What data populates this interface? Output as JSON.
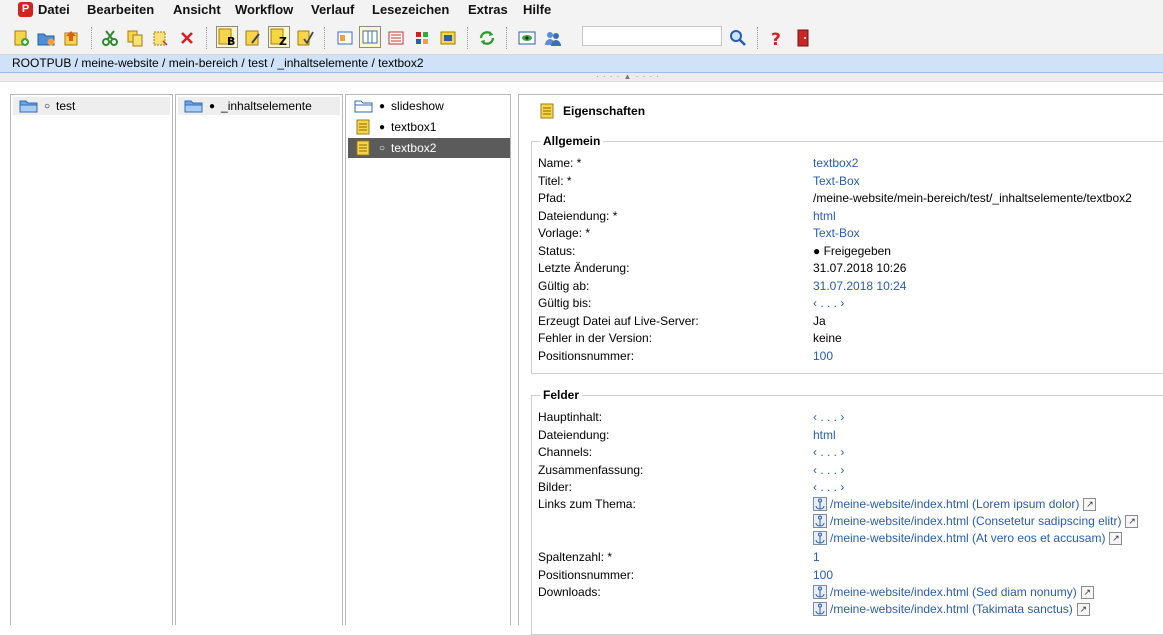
{
  "menu": [
    "Datei",
    "Bearbeiten",
    "Ansicht",
    "Workflow",
    "Verlauf",
    "Lesezeichen",
    "Extras",
    "Hilfe"
  ],
  "breadcrumb": "ROOTPUB / meine-website / mein-bereich / test / _inhaltselemente / textbox2",
  "search": {
    "value": ""
  },
  "columns": {
    "col1": [
      {
        "label": "test",
        "marker": "○"
      }
    ],
    "col2": [
      {
        "label": "_inhaltselemente",
        "marker": "●"
      }
    ],
    "col3": [
      {
        "label": "slideshow",
        "marker": "●"
      },
      {
        "label": "textbox1",
        "marker": "●"
      },
      {
        "label": "textbox2",
        "marker": "○"
      }
    ]
  },
  "properties": {
    "title": "Eigenschaften",
    "allgemein": {
      "legend": "Allgemein",
      "rows": [
        {
          "label": "Name: *",
          "value": "textbox2"
        },
        {
          "label": "Titel: *",
          "value": "Text-Box"
        },
        {
          "label": "Pfad:",
          "value": "/meine-website/mein-bereich/test/_inhaltselemente/textbox2"
        },
        {
          "label": "Dateiendung: *",
          "value": "html"
        },
        {
          "label": "Vorlage: *",
          "value": "Text-Box"
        },
        {
          "label": "Status:",
          "value": "● Freigegeben"
        },
        {
          "label": "Letzte Änderung:",
          "value": "31.07.2018 10:26"
        },
        {
          "label": "Gültig ab:",
          "value": "31.07.2018 10:24"
        },
        {
          "label": "Gültig bis:",
          "value": "‹ . . . ›"
        },
        {
          "label": "Erzeugt Datei auf Live-Server:",
          "value": "Ja"
        },
        {
          "label": "Fehler in der Version:",
          "value": "keine"
        },
        {
          "label": "Positionsnummer:",
          "value": "100"
        }
      ]
    },
    "felder": {
      "legend": "Felder",
      "rows": [
        {
          "label": "Hauptinhalt:",
          "value": "‹ . . . ›"
        },
        {
          "label": "Dateiendung:",
          "value": "html"
        },
        {
          "label": "Channels:",
          "value": "‹ . . . ›"
        },
        {
          "label": "Zusammenfassung:",
          "value": "‹ . . . ›"
        },
        {
          "label": "Bilder:",
          "value": "‹ . . . ›"
        },
        {
          "label": "Links zum Thema:",
          "links": [
            "/meine-website/index.html (Lorem ipsum dolor)",
            "/meine-website/index.html (Consetetur sadipscing elitr)",
            "/meine-website/index.html (At vero eos et accusam)"
          ]
        },
        {
          "label": "Spaltenzahl: *",
          "value": "1"
        },
        {
          "label": "Positionsnummer:",
          "value": "100"
        },
        {
          "label": "Downloads:",
          "links": [
            "/meine-website/index.html (Sed diam nonumy)",
            "/meine-website/index.html (Takimata sanctus)"
          ]
        }
      ]
    }
  },
  "icons": {
    "toolbar": [
      "new-page-icon",
      "new-folder-icon",
      "upload-icon",
      "cut-icon",
      "copy-icon",
      "paste-icon",
      "delete-icon",
      "bold-page-icon",
      "edit-page-icon",
      "z-page-icon",
      "check-page-icon",
      "view-icon-1",
      "view-columns-icon",
      "view-list-icon",
      "view-grid-icon",
      "view-card-icon",
      "refresh-icon",
      "preview-eye-icon",
      "users-icon",
      "search-icon",
      "help-icon",
      "exit-icon"
    ]
  }
}
